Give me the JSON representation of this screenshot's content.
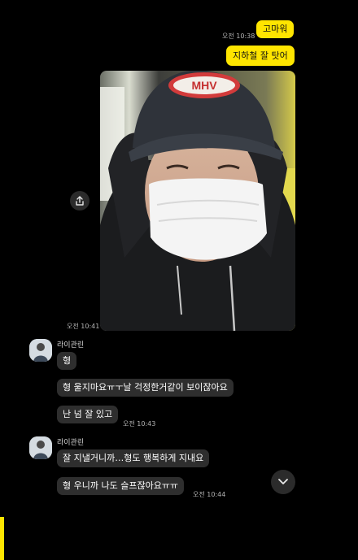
{
  "messages": {
    "m1": {
      "text": "고마워",
      "time": "오전 10:38"
    },
    "m2": {
      "text": "지하철 잘 탓어"
    },
    "photo": {
      "time": "오전 10:41",
      "cap_text": "MHV"
    },
    "group1": {
      "sender": "라이관린",
      "lines": [
        "형",
        "형 울지마요ㅠㅜ날 걱정한거같이 보이잖아요",
        "난 넘 잘 있고"
      ],
      "time": "오전 10:43"
    },
    "group2": {
      "sender": "라이관린",
      "lines": [
        "잘 지낼거니까…형도 행복하게 지내요",
        "형 우니까 나도 슬프잖아요ㅠㅠ"
      ],
      "time": "오전 10:44"
    }
  },
  "icons": {
    "share": "share-icon",
    "scroll_down": "chevron-down-icon"
  },
  "colors": {
    "background": "#000000",
    "my_bubble": "#FEE500",
    "other_bubble": "#2E2E2E",
    "time_text": "#B5B5B5"
  }
}
